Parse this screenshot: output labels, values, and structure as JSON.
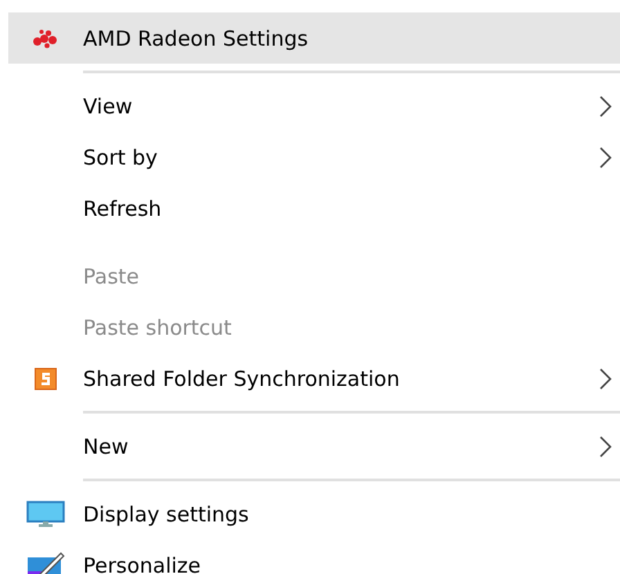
{
  "menu": {
    "items": [
      {
        "kind": "item",
        "label": "AMD Radeon Settings",
        "selected": true,
        "disabled": false,
        "submenu": false
      },
      {
        "kind": "separator"
      },
      {
        "kind": "item",
        "label": "View",
        "selected": false,
        "disabled": false,
        "submenu": true
      },
      {
        "kind": "item",
        "label": "Sort by",
        "selected": false,
        "disabled": false,
        "submenu": true
      },
      {
        "kind": "item",
        "label": "Refresh",
        "selected": false,
        "disabled": false,
        "submenu": false
      },
      {
        "kind": "gap"
      },
      {
        "kind": "item",
        "label": "Paste",
        "selected": false,
        "disabled": true,
        "submenu": false
      },
      {
        "kind": "item",
        "label": "Paste shortcut",
        "selected": false,
        "disabled": true,
        "submenu": false
      },
      {
        "kind": "item",
        "label": "Shared Folder Synchronization",
        "selected": false,
        "disabled": false,
        "submenu": true
      },
      {
        "kind": "separator"
      },
      {
        "kind": "item",
        "label": "New",
        "selected": false,
        "disabled": false,
        "submenu": true
      },
      {
        "kind": "separator"
      },
      {
        "kind": "item",
        "label": "Display settings",
        "selected": false,
        "disabled": false,
        "submenu": false
      },
      {
        "kind": "item",
        "label": "Personalize",
        "selected": false,
        "disabled": false,
        "submenu": false
      }
    ]
  }
}
